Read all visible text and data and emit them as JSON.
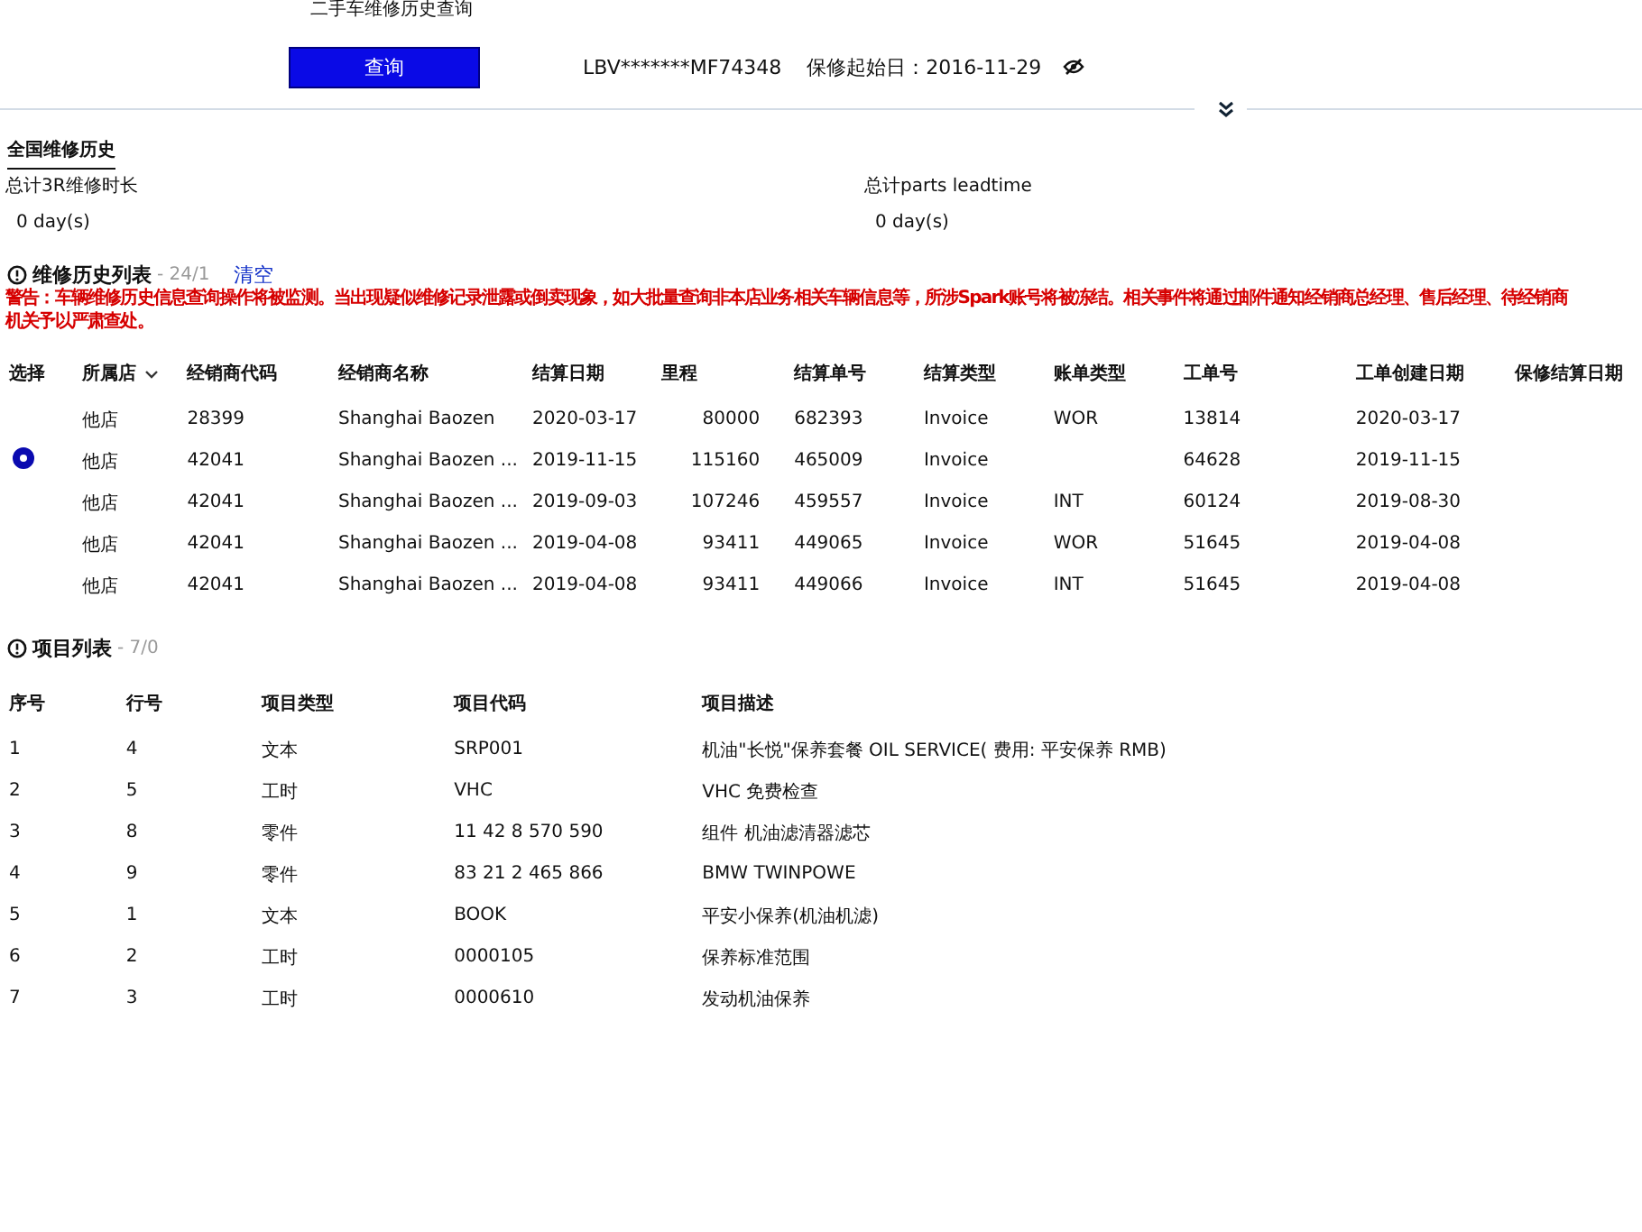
{
  "breadcrumb": {
    "current": "二手车维修历史查询"
  },
  "search": {
    "button": "查询",
    "vin": "LBV*******MF74348",
    "warranty_start": "保修起始日：2016-11-29"
  },
  "section_tab": "全国维修历史",
  "stats": [
    {
      "label": "总计3R维修时长",
      "value": "0 day(s)"
    },
    {
      "label": "总计parts leadtime",
      "value": "0 day(s)"
    }
  ],
  "history": {
    "title": "维修历史列表",
    "count": "- 24/1",
    "clear": "清空",
    "warning": [
      "警告：车辆维修历史信息查询操作将被监测。当出现疑似维修记录泄露或倒卖现象，如大批量查询非本店业务相关车辆信息等，所涉Spark账号将被冻结。相关事件将通过邮件通知经销商总经理、售后经理、待经销商",
      "机关予以严肃查处。"
    ],
    "columns": [
      "选择",
      "所属店",
      "经销商代码",
      "经销商名称",
      "结算日期",
      "里程",
      "结算单号",
      "结算类型",
      "账单类型",
      "工单号",
      "工单创建日期",
      "保修结算日期"
    ],
    "rows": [
      {
        "selected": false,
        "cells": [
          "",
          "他店",
          "28399",
          "Shanghai Baozen",
          "2020-03-17",
          "80000",
          "682393",
          "Invoice",
          "WOR",
          "13814",
          "2020-03-17"
        ]
      },
      {
        "selected": true,
        "cells": [
          "",
          "他店",
          "42041",
          "Shanghai Baozen ...",
          "2019-11-15",
          "115160",
          "465009",
          "Invoice",
          "",
          "64628",
          "2019-11-15"
        ]
      },
      {
        "selected": false,
        "cells": [
          "",
          "他店",
          "42041",
          "Shanghai Baozen ...",
          "2019-09-03",
          "107246",
          "459557",
          "Invoice",
          "INT",
          "60124",
          "2019-08-30"
        ]
      },
      {
        "selected": false,
        "cells": [
          "",
          "他店",
          "42041",
          "Shanghai Baozen ...",
          "2019-04-08",
          "93411",
          "449065",
          "Invoice",
          "WOR",
          "51645",
          "2019-04-08"
        ]
      },
      {
        "selected": false,
        "cells": [
          "",
          "他店",
          "42041",
          "Shanghai Baozen ...",
          "2019-04-08",
          "93411",
          "449066",
          "Invoice",
          "INT",
          "51645",
          "2019-04-08"
        ]
      }
    ]
  },
  "items": {
    "title": "项目列表",
    "count": "- 7/0",
    "columns": [
      "序号",
      "行号",
      "项目类型",
      "项目代码",
      "项目描述"
    ],
    "rows": [
      [
        "1",
        "4",
        "文本",
        "SRP001",
        "机油\"长悦\"保养套餐  OIL SERVICE( 费用: 平安保养   RMB)"
      ],
      [
        "2",
        "5",
        "工时",
        "VHC",
        "VHC 免费检查"
      ],
      [
        "3",
        "8",
        "零件",
        "11 42 8 570 590",
        "组件 机油滤清器滤芯"
      ],
      [
        "4",
        "9",
        "零件",
        "83 21 2 465 866",
        "BMW TWINPOWE"
      ],
      [
        "5",
        "1",
        "文本",
        "BOOK",
        "平安小保养(机油机滤)"
      ],
      [
        "6",
        "2",
        "工时",
        "0000105",
        "保养标准范围"
      ],
      [
        "7",
        "3",
        "工时",
        "0000610",
        "发动机油保养"
      ]
    ]
  }
}
